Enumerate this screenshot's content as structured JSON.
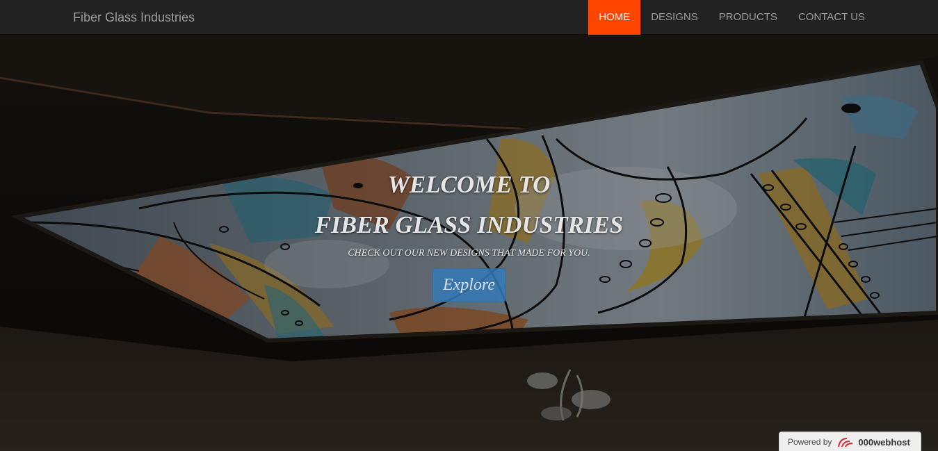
{
  "navbar": {
    "brand": "Fiber Glass Industries",
    "items": [
      {
        "label": "HOME",
        "active": true
      },
      {
        "label": "DESIGNS",
        "active": false
      },
      {
        "label": "PRODUCTS",
        "active": false
      },
      {
        "label": "CONTACT US",
        "active": false
      }
    ],
    "active_color": "#ff4500"
  },
  "hero": {
    "title_line1": "WELCOME TO",
    "title_line2": "FIBER GLASS INDUSTRIES",
    "subtitle": "CHECK OUT OUR NEW DESIGNS THAT MADE FOR YOU.",
    "button_label": "Explore",
    "button_color": "#337ab7"
  },
  "badge": {
    "powered_by": "Powered by",
    "host_name": "000webhost",
    "logo_icon": "000webhost-logo-icon"
  }
}
